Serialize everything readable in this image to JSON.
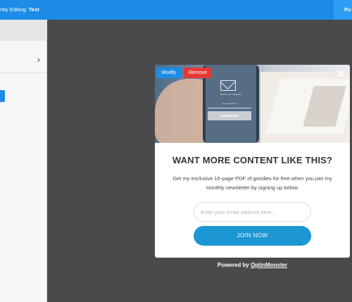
{
  "topbar": {
    "editing_prefix": "ntly Editing:",
    "editing_name": "Test",
    "publish_label": "Pu"
  },
  "sidebar": {
    "row_icon": "chevron-right-icon"
  },
  "popup": {
    "modify_label": "Modify",
    "remove_label": "Remove",
    "close_icon": "close-icon",
    "hero": {
      "mini_text": "Receive our newsletter",
      "mini_field": "Your email here",
      "mini_button": "SUBSCRIBE"
    },
    "headline": "WANT MORE CONTENT LIKE THIS?",
    "body": "Get my exclusive 16-page PDF of goodies for free when you join my monthly newsletter by signing up below.",
    "email_placeholder": "Enter your email address here...",
    "join_label": "JOIN NOW"
  },
  "footer": {
    "powered_prefix": "Powered by",
    "powered_link": "OptinMonster"
  },
  "colors": {
    "accent": "#1c8ce6",
    "remove": "#e53935",
    "join": "#1c97d4",
    "canvas": "#4a4a4a"
  }
}
